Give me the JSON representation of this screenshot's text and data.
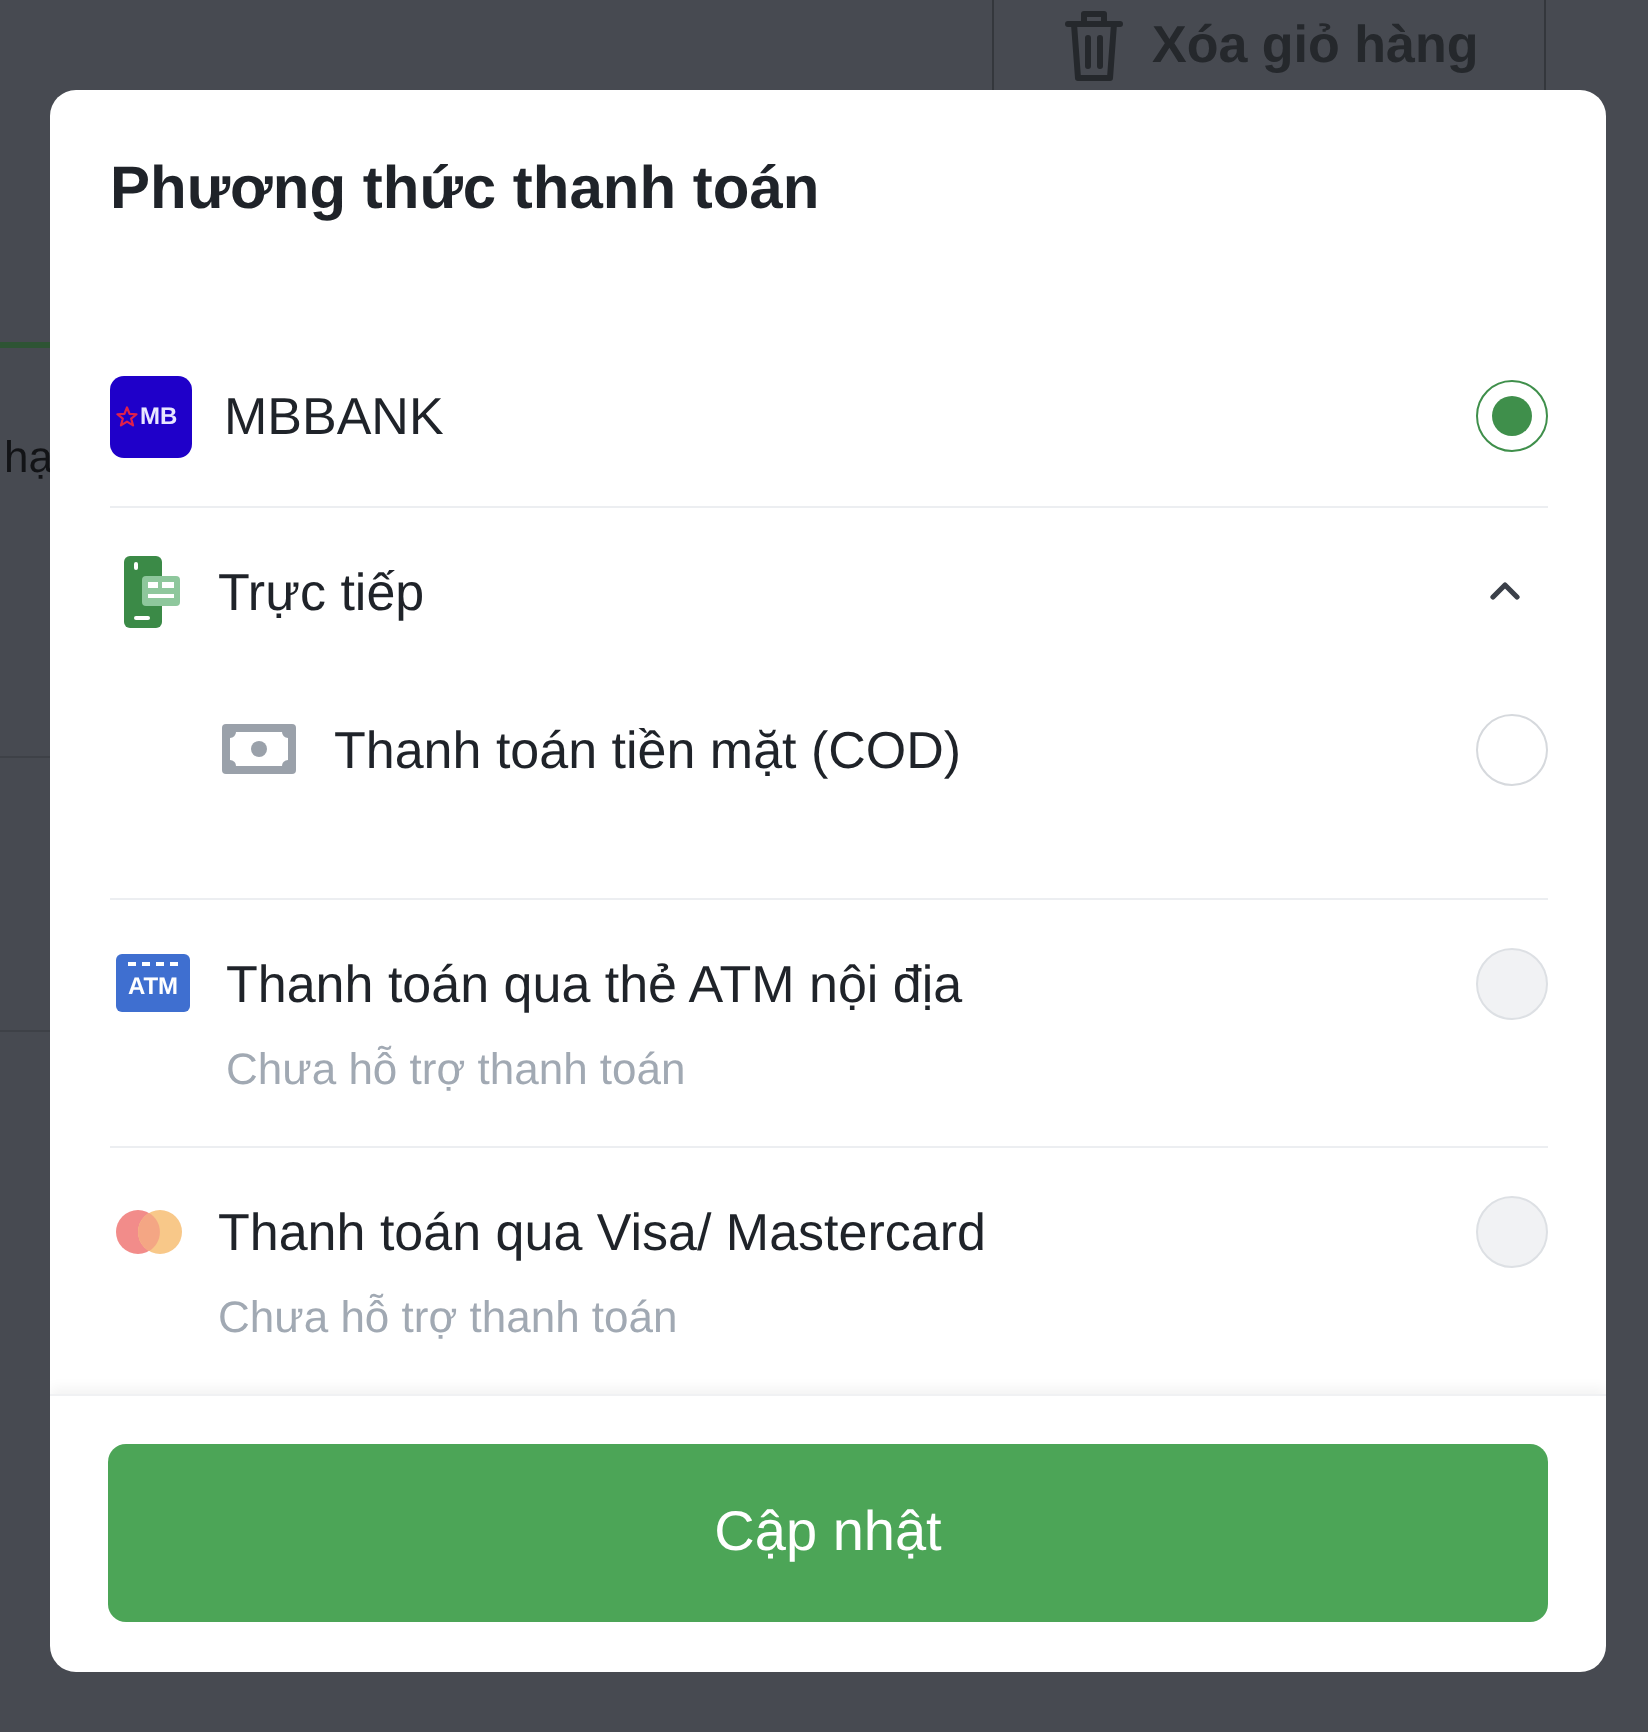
{
  "background": {
    "clear_cart_button": "Xóa giỏ hàng",
    "tab_label": "hạ"
  },
  "dialog": {
    "title": "Phương thức thanh toán",
    "methods": [
      {
        "kind": "bank",
        "icon_text": "MB",
        "label": "MBBANK",
        "selected": true,
        "disabled": false
      },
      {
        "kind": "group",
        "label": "Trực tiếp",
        "expanded": true,
        "children": [
          {
            "kind": "cash",
            "label": "Thanh toán tiền mặt (COD)",
            "selected": false,
            "disabled": false
          }
        ]
      },
      {
        "kind": "atm",
        "icon_text": "ATM",
        "label": "Thanh toán qua thẻ ATM nội địa",
        "note": "Chưa hỗ trợ thanh toán",
        "selected": false,
        "disabled": true
      },
      {
        "kind": "card",
        "label": "Thanh toán qua Visa/ Mastercard",
        "note": "Chưa hỗ trợ thanh toán",
        "selected": false,
        "disabled": true
      }
    ],
    "submit_button": "Cập nhật"
  }
}
